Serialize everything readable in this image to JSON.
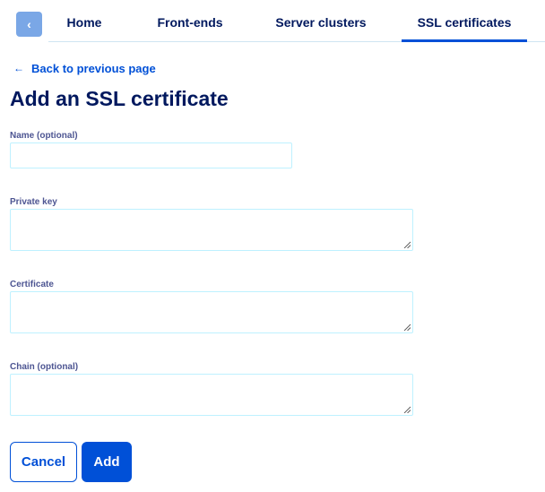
{
  "nav": {
    "back_icon": "chevron-left-icon",
    "tabs": [
      {
        "label": "Home"
      },
      {
        "label": "Front-ends"
      },
      {
        "label": "Server clusters"
      },
      {
        "label": "SSL certificates",
        "active": true
      }
    ]
  },
  "back_link": {
    "icon": "arrow-left-icon",
    "label": "Back to previous page"
  },
  "title": "Add an SSL certificate",
  "form": {
    "name": {
      "label": "Name (optional)",
      "value": ""
    },
    "private_key": {
      "label": "Private key",
      "value": ""
    },
    "certificate": {
      "label": "Certificate",
      "value": ""
    },
    "chain": {
      "label": "Chain (optional)",
      "value": ""
    }
  },
  "actions": {
    "cancel_label": "Cancel",
    "add_label": "Add"
  },
  "colors": {
    "primary": "#0050d7",
    "heading": "#00185e",
    "input_border": "#bef1ff"
  }
}
